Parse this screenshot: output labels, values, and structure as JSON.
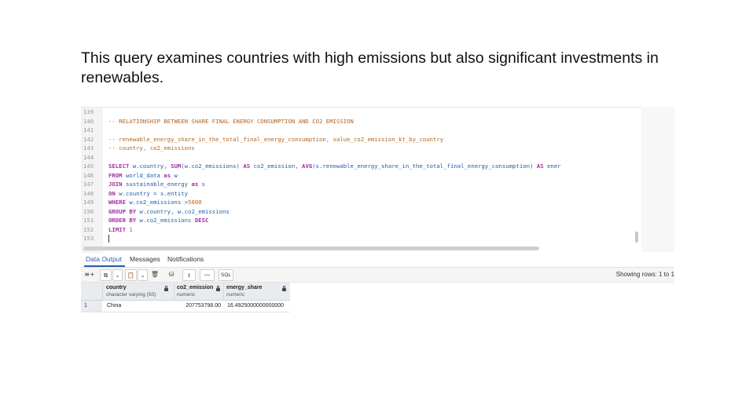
{
  "intro": {
    "text": "This query examines countries with high emissions but also significant investments in renewables."
  },
  "editor": {
    "lines": [
      {
        "num": "139"
      },
      {
        "num": "140",
        "comment": "-- RELATIONSHIP BETWEEN SHARE FINAL ENERGY CONSUMPTION AND CO2 EMISSION"
      },
      {
        "num": "141"
      },
      {
        "num": "142",
        "comment": "-- renewable_energy_share_in_the_total_final_energy_consumption, value_co2_emission_kt_by_country"
      },
      {
        "num": "143",
        "comment": "-- country, co2_emissions"
      },
      {
        "num": "144"
      },
      {
        "num": "145",
        "kw1": "SELECT",
        "t1": " w.country, ",
        "kw2": "SUM",
        "t2": "(w.co2_emissions) ",
        "kw3": "AS",
        "t3": " co2_emission, ",
        "kw4": "AVG",
        "t4": "(s.renewable_energy_share_in_the_total_final_energy_consumption) ",
        "kw5": "AS",
        "t5": " ener"
      },
      {
        "num": "146",
        "kw1": "FROM",
        "t1": " world_data ",
        "kw2": "as",
        "t2": " w"
      },
      {
        "num": "147",
        "kw1": "JOIN",
        "t1": " sustainable_energy ",
        "kw2": "as",
        "t2": " s"
      },
      {
        "num": "148",
        "kw1": "ON",
        "t1": " w.country = s.entity"
      },
      {
        "num": "149",
        "kw1": "WHERE",
        "t1": " w.co2_emissions >",
        "n1": "5000"
      },
      {
        "num": "150",
        "kw1": "GROUP BY",
        "t1": " w.country, w.co2_emissions"
      },
      {
        "num": "151",
        "kw1": "ORDER BY",
        "t1": " w.co2_emissions ",
        "kw2": "DESC"
      },
      {
        "num": "152",
        "kw1": "LIMIT",
        "t1": " ",
        "n1": "1"
      },
      {
        "num": "153"
      }
    ]
  },
  "tabs": {
    "data_output": "Data Output",
    "messages": "Messages",
    "notifications": "Notifications"
  },
  "toolbar": {
    "sql_label": "SQL",
    "rows_info": "Showing rows: 1 to 1"
  },
  "grid": {
    "columns": [
      {
        "name": "country",
        "type": "character varying (50)"
      },
      {
        "name": "co2_emission",
        "type": "numeric"
      },
      {
        "name": "energy_share",
        "type": "numeric"
      }
    ],
    "rows": [
      {
        "num": "1",
        "country": "China",
        "co2_emission": "207753798.00",
        "energy_share": "16.4925000000000000"
      }
    ]
  },
  "colors": {
    "keyword": "#a42ea2",
    "comment": "#b5651d",
    "accent": "#2b5ea7"
  }
}
